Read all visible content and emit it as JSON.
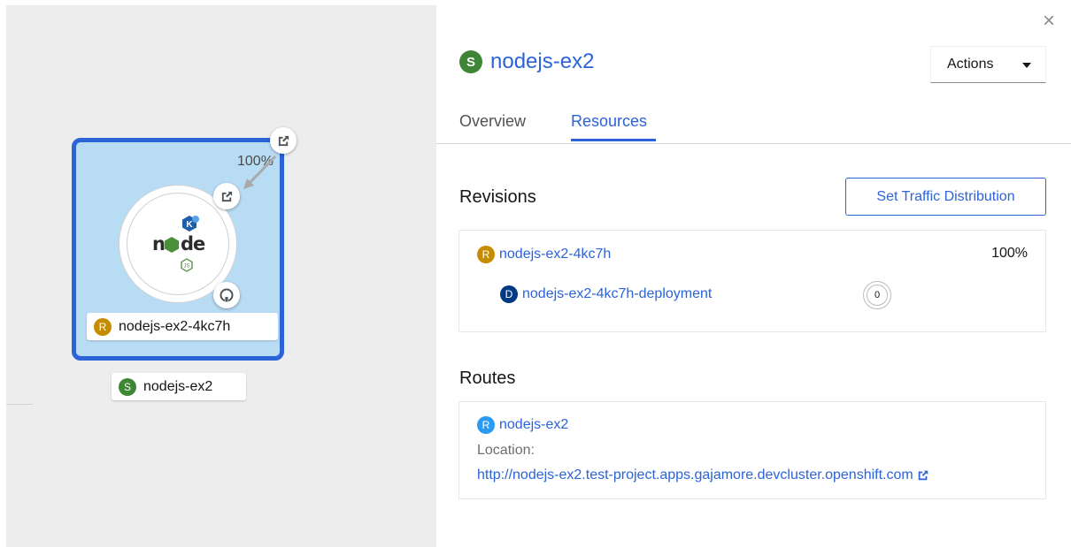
{
  "topology": {
    "traffic_percent": "100%",
    "revision_chip": {
      "badge": "R",
      "label": "nodejs-ex2-4kc7h"
    },
    "service_chip": {
      "badge": "S",
      "label": "nodejs-ex2"
    },
    "node_icon": "node-logo",
    "knative_badge": "K"
  },
  "panel": {
    "title_badge": "S",
    "title": "nodejs-ex2",
    "actions_label": "Actions",
    "close_glyph": "×",
    "tabs": [
      {
        "label": "Overview",
        "active": false
      },
      {
        "label": "Resources",
        "active": true
      }
    ],
    "revisions": {
      "heading": "Revisions",
      "button_label": "Set Traffic Distribution",
      "revision": {
        "badge": "R",
        "name": "nodejs-ex2-4kc7h",
        "percent": "100%"
      },
      "deployment": {
        "badge": "D",
        "name": "nodejs-ex2-4kc7h-deployment",
        "pod_count": "0"
      }
    },
    "routes": {
      "heading": "Routes",
      "route": {
        "badge": "R",
        "name": "nodejs-ex2"
      },
      "location_label": "Location:",
      "location_url": "http://nodejs-ex2.test-project.apps.gajamore.devcluster.openshift.com"
    }
  },
  "colors": {
    "link_blue": "#2b63d9",
    "service_green": "#3e8635",
    "revision_gold": "#c58c00",
    "deployment_navy": "#003a85",
    "route_blue": "#2b9af3",
    "group_fill": "#b8dcf4"
  }
}
